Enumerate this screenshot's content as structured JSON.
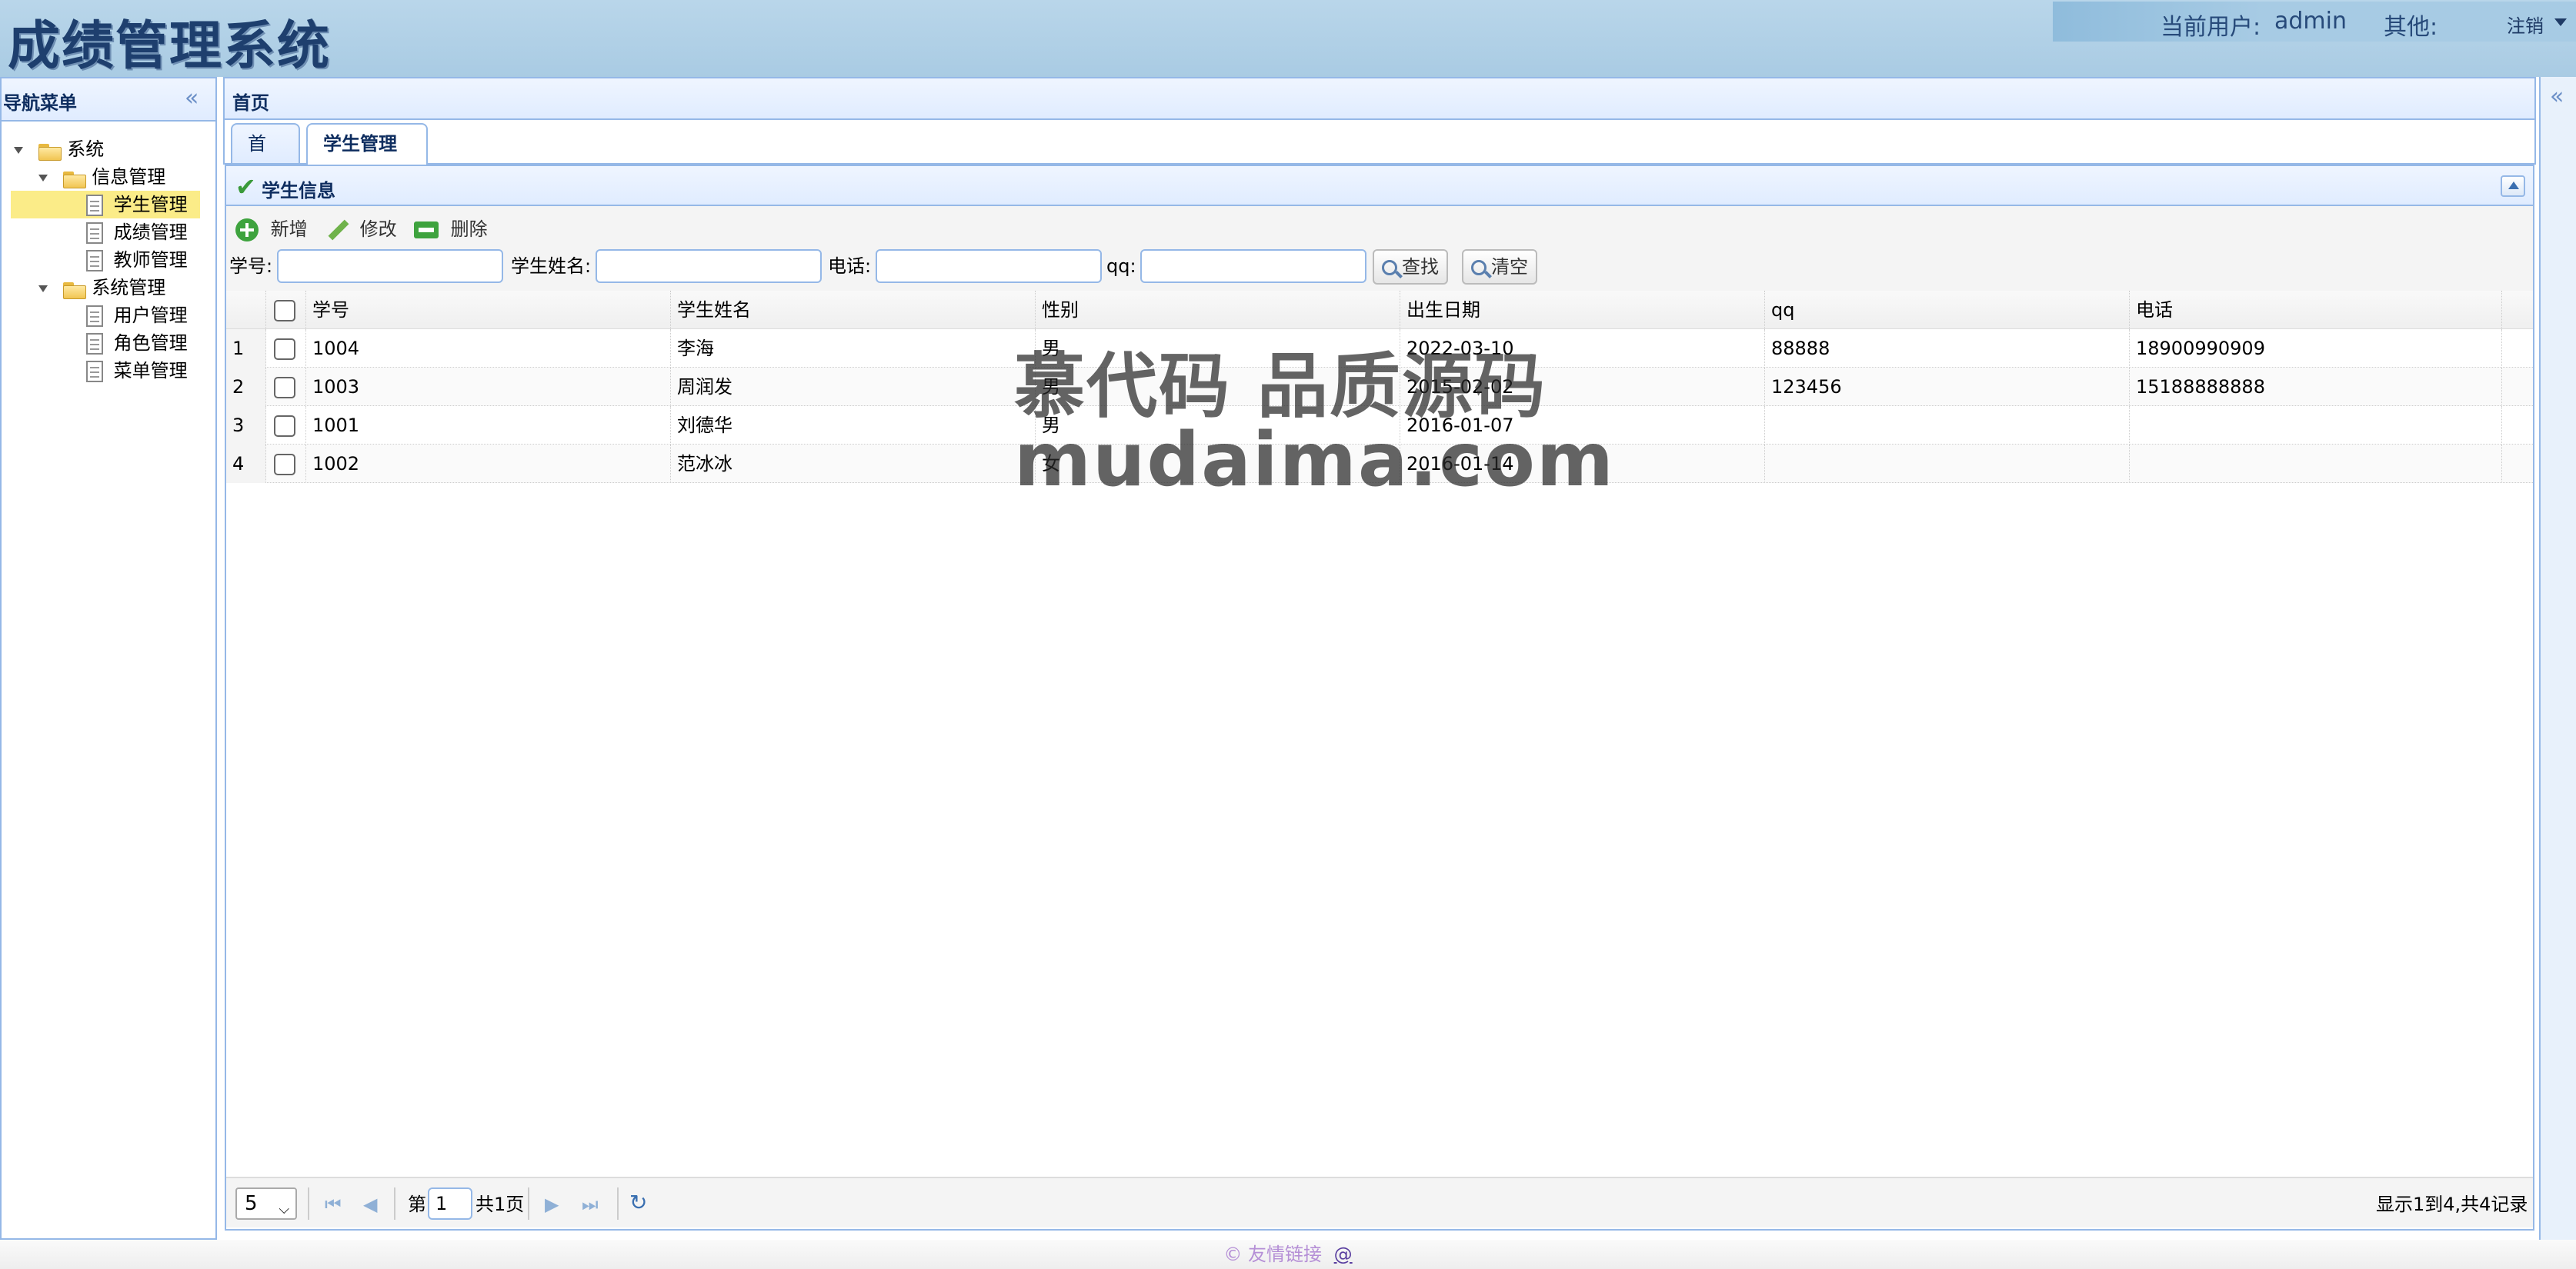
{
  "header": {
    "app_title": "成绩管理系统",
    "current_user_label": "当前用户:",
    "username": "admin",
    "other_label": "其他:",
    "logout": "注销"
  },
  "west": {
    "title": "导航菜单",
    "tree": [
      {
        "label": "系统",
        "level": 0,
        "type": "folder"
      },
      {
        "label": "信息管理",
        "level": 1,
        "type": "folder"
      },
      {
        "label": "学生管理",
        "level": 2,
        "type": "file",
        "selected": true
      },
      {
        "label": "成绩管理",
        "level": 2,
        "type": "file"
      },
      {
        "label": "教师管理",
        "level": 2,
        "type": "file"
      },
      {
        "label": "系统管理",
        "level": 1,
        "type": "folder"
      },
      {
        "label": "用户管理",
        "level": 2,
        "type": "file"
      },
      {
        "label": "角色管理",
        "level": 2,
        "type": "file"
      },
      {
        "label": "菜单管理",
        "level": 2,
        "type": "file"
      }
    ]
  },
  "center": {
    "title": "首页",
    "tabs": [
      {
        "label": "首页",
        "active": false
      },
      {
        "label": "学生管理",
        "active": true,
        "closable": true
      }
    ],
    "close_glyph": "×",
    "panel_title": "学生信息",
    "toolbar": {
      "add": "新增",
      "edit": "修改",
      "delete": "删除"
    },
    "search": {
      "student_id_label": "学号:",
      "student_name_label": "学生姓名:",
      "phone_label": "电话:",
      "qq_label": "qq:",
      "search_button": "查找",
      "clear_button": "清空"
    },
    "grid": {
      "columns": [
        "学号",
        "学生姓名",
        "性别",
        "出生日期",
        "qq",
        "电话"
      ],
      "rows": [
        {
          "n": "1",
          "cells": [
            "1004",
            "李海",
            "男",
            "2022-03-10",
            "88888",
            "18900990909"
          ]
        },
        {
          "n": "2",
          "cells": [
            "1003",
            "周润发",
            "男",
            "2015-02-02",
            "123456",
            "15188888888"
          ]
        },
        {
          "n": "3",
          "cells": [
            "1001",
            "刘德华",
            "男",
            "2016-01-07",
            "",
            ""
          ]
        },
        {
          "n": "4",
          "cells": [
            "1002",
            "范冰冰",
            "女",
            "2016-01-14",
            "",
            ""
          ]
        }
      ]
    },
    "pager": {
      "page_size": "5",
      "page_prefix": "第",
      "page_value": "1",
      "page_total": "共1页",
      "summary": "显示1到4,共4记录"
    }
  },
  "footer": {
    "text": "© 友情链接",
    "link": "@"
  },
  "watermark": {
    "line1": "慕代码 品质源码",
    "line2": "mudaima.com"
  },
  "colors": {
    "header_bg": "#b0d1e8",
    "border": "#95b8e7",
    "title": "#1e3f6e",
    "selected": "#fbec88",
    "footer_text": "#b58fd6"
  }
}
